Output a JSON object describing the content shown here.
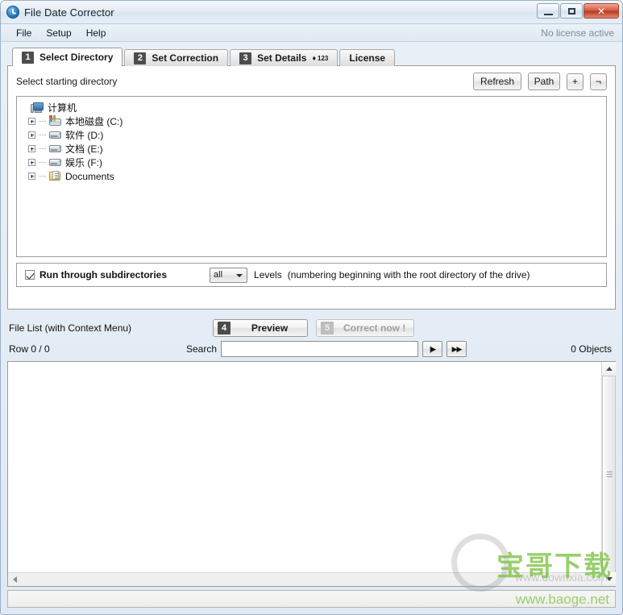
{
  "window": {
    "title": "File Date Corrector",
    "app_icon": "clock-icon",
    "buttons": {
      "minimize": "minimize-icon",
      "maximize": "maximize-icon",
      "close": "✕"
    }
  },
  "menubar": {
    "items": [
      "File",
      "Setup",
      "Help"
    ],
    "license_status": "No license active"
  },
  "tabs": [
    {
      "badge": "1",
      "label": "Select Directory",
      "active": true
    },
    {
      "badge": "2",
      "label": "Set Correction",
      "active": false
    },
    {
      "badge": "3",
      "label": "Set Details",
      "suffix_diamond": "♦",
      "suffix_sup": "123",
      "active": false
    },
    {
      "badge": "",
      "label": "License",
      "active": false
    }
  ],
  "select_directory": {
    "label": "Select starting directory",
    "refresh_label": "Refresh",
    "path_label": "Path",
    "add_label": "+",
    "remove_label": "¬",
    "tree": [
      {
        "label": "计算机",
        "icon": "computer-icon",
        "level": 0,
        "expandable": false
      },
      {
        "label": "本地磁盘 (C:)",
        "icon": "hdd-windows-icon",
        "level": 1,
        "expandable": true
      },
      {
        "label": "软件 (D:)",
        "icon": "drive-icon",
        "level": 1,
        "expandable": true
      },
      {
        "label": "文档 (E:)",
        "icon": "drive-icon",
        "level": 1,
        "expandable": true
      },
      {
        "label": "娱乐 (F:)",
        "icon": "drive-icon",
        "level": 1,
        "expandable": true
      },
      {
        "label": "Documents",
        "icon": "documents-folder-icon",
        "level": 1,
        "expandable": true
      }
    ],
    "subdirectories": {
      "checkbox_label": "Run through subdirectories",
      "checked": true,
      "levels_value": "all",
      "levels_label": "Levels",
      "levels_note": "(numbering beginning with the root directory of the drive)"
    }
  },
  "file_list": {
    "label": "File List (with Context Menu)",
    "preview_badge": "4",
    "preview_label": "Preview",
    "correct_badge": "5",
    "correct_label": "Correct now !",
    "correct_disabled": true,
    "row_count": "Row 0 / 0",
    "search_label": "Search",
    "search_value": "",
    "search_placeholder": "",
    "find_first_label": "|▶",
    "find_next_label": "▶▶",
    "objects_count": "0 Objects"
  },
  "watermark": {
    "grey_url": "www.downxia.com",
    "green_text": "宝哥下载",
    "green_url": "www.baoge.net"
  },
  "colors": {
    "accent": "#4d4d4d",
    "title_bar": "#e4ecf4",
    "close_button": "#bb3a21",
    "watermark_green": "#7cc142"
  }
}
